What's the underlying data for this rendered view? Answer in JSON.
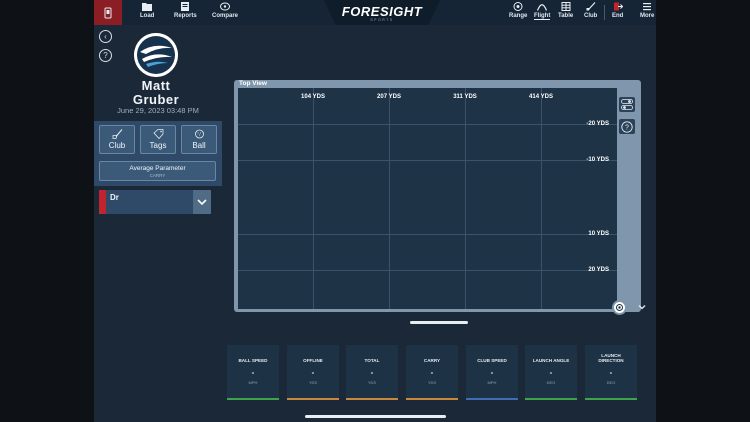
{
  "nav": {
    "items": [
      {
        "label": "Load",
        "icon": "folder-icon"
      },
      {
        "label": "Reports",
        "icon": "reports-icon"
      },
      {
        "label": "Compare",
        "icon": "compare-icon"
      },
      {
        "label": "Range",
        "icon": "range-icon"
      },
      {
        "label": "Flight",
        "icon": "flight-icon",
        "active": true
      },
      {
        "label": "Table",
        "icon": "table-icon"
      },
      {
        "label": "Club",
        "icon": "club-icon"
      },
      {
        "label": "End",
        "icon": "exit-icon"
      },
      {
        "label": "More",
        "icon": "menu-icon"
      }
    ]
  },
  "brand": {
    "name": "FORESIGHT",
    "sub": "SPORTS"
  },
  "player": {
    "first_name": "Matt",
    "last_name": "Gruber",
    "date": "June 29, 2023   03:48 PM"
  },
  "filters": {
    "club_label": "Club",
    "tags_label": "Tags",
    "ball_label": "Ball",
    "avg_title": "Average Parameter",
    "avg_sub": "CARRY"
  },
  "club_select": {
    "value": "Dr"
  },
  "top_view": {
    "title": "Top View",
    "distance_labels": [
      "104 YDS",
      "207 YDS",
      "311 YDS",
      "414 YDS"
    ],
    "lateral_labels": [
      "-20 YDS",
      "-10 YDS",
      "10 YDS",
      "20 YDS"
    ]
  },
  "stats": [
    {
      "label": "BALL SPEED",
      "value": "-",
      "unit": "MPH",
      "color": "#3fa34d"
    },
    {
      "label": "OFFLINE",
      "value": "-",
      "unit": "YDS",
      "color": "#c9893a"
    },
    {
      "label": "TOTAL",
      "value": "-",
      "unit": "YDS",
      "color": "#c9893a"
    },
    {
      "label": "CARRY",
      "value": "-",
      "unit": "YDS",
      "color": "#c9893a"
    },
    {
      "label": "CLUB SPEED",
      "value": "-",
      "unit": "MPH",
      "color": "#3f6fb0"
    },
    {
      "label": "LAUNCH ANGLE",
      "value": "-",
      "unit": "DEG",
      "color": "#3fa34d"
    },
    {
      "label": "LAUNCH DIRECTION",
      "value": "-",
      "unit": "DEG",
      "color": "#3fa34d"
    }
  ],
  "colors": {
    "accent_red": "#c0242c",
    "panel": "#2e4a68",
    "background": "#1b2838"
  }
}
